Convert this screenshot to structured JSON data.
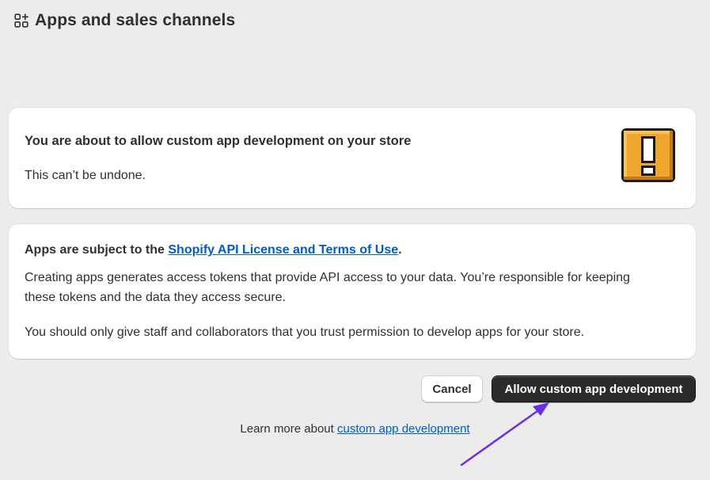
{
  "header": {
    "title": "Apps and sales channels",
    "icon": "apps-icon"
  },
  "warning_card": {
    "heading": "You are about to allow custom app development on your store",
    "subtext": "This can’t be undone.",
    "icon": "warning-exclamation-icon",
    "icon_color": "#f0a52c"
  },
  "info_card": {
    "terms_prefix": "Apps are subject to the ",
    "terms_link": "Shopify API License and Terms of Use",
    "terms_suffix": ".",
    "paragraph1": "Creating apps generates access tokens that provide API access to your data. You’re responsible for keeping these tokens and the data they access secure.",
    "paragraph2": "You should only give staff and collaborators that you trust permission to develop apps for your store."
  },
  "actions": {
    "cancel_label": "Cancel",
    "allow_label": "Allow custom app development"
  },
  "footer": {
    "learn_prefix": "Learn more about ",
    "learn_link": "custom app development"
  },
  "colors": {
    "background": "#ececec",
    "link": "#005bd3",
    "primary_button": "#2b2b2b",
    "annotation_arrow": "#6b2ee8"
  }
}
